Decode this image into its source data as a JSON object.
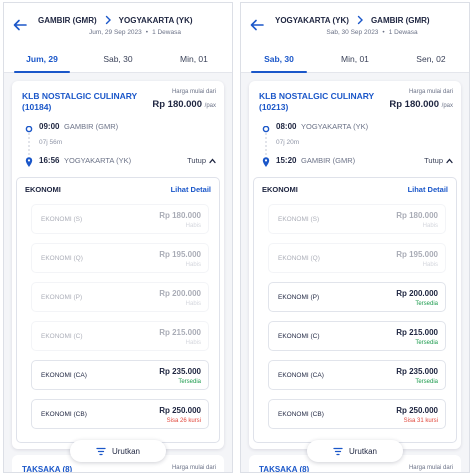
{
  "colors": {
    "accent": "#1b57c9",
    "available": "#1d9b4e",
    "low_stock": "#e0463b",
    "text": "#1e2540"
  },
  "left": {
    "route": {
      "from": "GAMBIR (GMR)",
      "to": "YOGYAKARTA (YK)"
    },
    "date": "Jum, 29 Sep 2023",
    "passengers": "1 Dewasa",
    "tabs": [
      {
        "label": "Jum, 29",
        "active": true
      },
      {
        "label": "Sab, 30"
      },
      {
        "label": "Min, 01"
      }
    ],
    "train": {
      "name": "KLB NOSTALGIC CULINARY (10184)",
      "price_label": "Harga mulai dari",
      "price": "Rp 180.000",
      "per": "/pax",
      "dep_time": "09:00",
      "dep_station": "GAMBIR (GMR)",
      "duration": "07j 56m",
      "arr_time": "16:56",
      "arr_station": "YOGYAKARTA (YK)",
      "toggle": "Tutup",
      "class_title": "EKONOMI",
      "detail_link": "Lihat Detail",
      "rows": [
        {
          "name": "EKONOMI (S)",
          "price": "Rp 180.000",
          "status": "Habis"
        },
        {
          "name": "EKONOMI (Q)",
          "price": "Rp 195.000",
          "status": "Habis"
        },
        {
          "name": "EKONOMI (P)",
          "price": "Rp 200.000",
          "status": "Habis"
        },
        {
          "name": "EKONOMI (C)",
          "price": "Rp 215.000",
          "status": "Habis"
        },
        {
          "name": "EKONOMI (CA)",
          "price": "Rp 235.000",
          "status": "Tersedia"
        },
        {
          "name": "EKONOMI (CB)",
          "price": "Rp 250.000",
          "status": "Sisa 26 kursi"
        }
      ]
    },
    "sort_label": "Urutkan",
    "next_card": {
      "name": "TAKSAKA (8)",
      "price_label": "Harga mulai dari"
    }
  },
  "right": {
    "route": {
      "from": "YOGYAKARTA (YK)",
      "to": "GAMBIR (GMR)"
    },
    "date": "Sab, 30 Sep 2023",
    "passengers": "1 Dewasa",
    "tabs": [
      {
        "label": "Sab, 30",
        "active": true
      },
      {
        "label": "Min, 01"
      },
      {
        "label": "Sen, 02"
      }
    ],
    "train": {
      "name": "KLB NOSTALGIC CULINARY (10213)",
      "price_label": "Harga mulai dari",
      "price": "Rp 180.000",
      "per": "/pax",
      "dep_time": "08:00",
      "dep_station": "YOGYAKARTA (YK)",
      "duration": "07j 20m",
      "arr_time": "15:20",
      "arr_station": "GAMBIR (GMR)",
      "toggle": "Tutup",
      "class_title": "EKONOMI",
      "detail_link": "Lihat Detail",
      "rows": [
        {
          "name": "EKONOMI (S)",
          "price": "Rp 180.000",
          "status": "Habis"
        },
        {
          "name": "EKONOMI (Q)",
          "price": "Rp 195.000",
          "status": "Habis"
        },
        {
          "name": "EKONOMI (P)",
          "price": "Rp 200.000",
          "status": "Tersedia"
        },
        {
          "name": "EKONOMI (C)",
          "price": "Rp 215.000",
          "status": "Tersedia"
        },
        {
          "name": "EKONOMI (CA)",
          "price": "Rp 235.000",
          "status": "Tersedia"
        },
        {
          "name": "EKONOMI (CB)",
          "price": "Rp 250.000",
          "status": "Sisa 31 kursi"
        }
      ]
    },
    "sort_label": "Urutkan",
    "next_card": {
      "name": "TAKSAKA (8)",
      "price_label": "Harga mulai dari"
    }
  }
}
